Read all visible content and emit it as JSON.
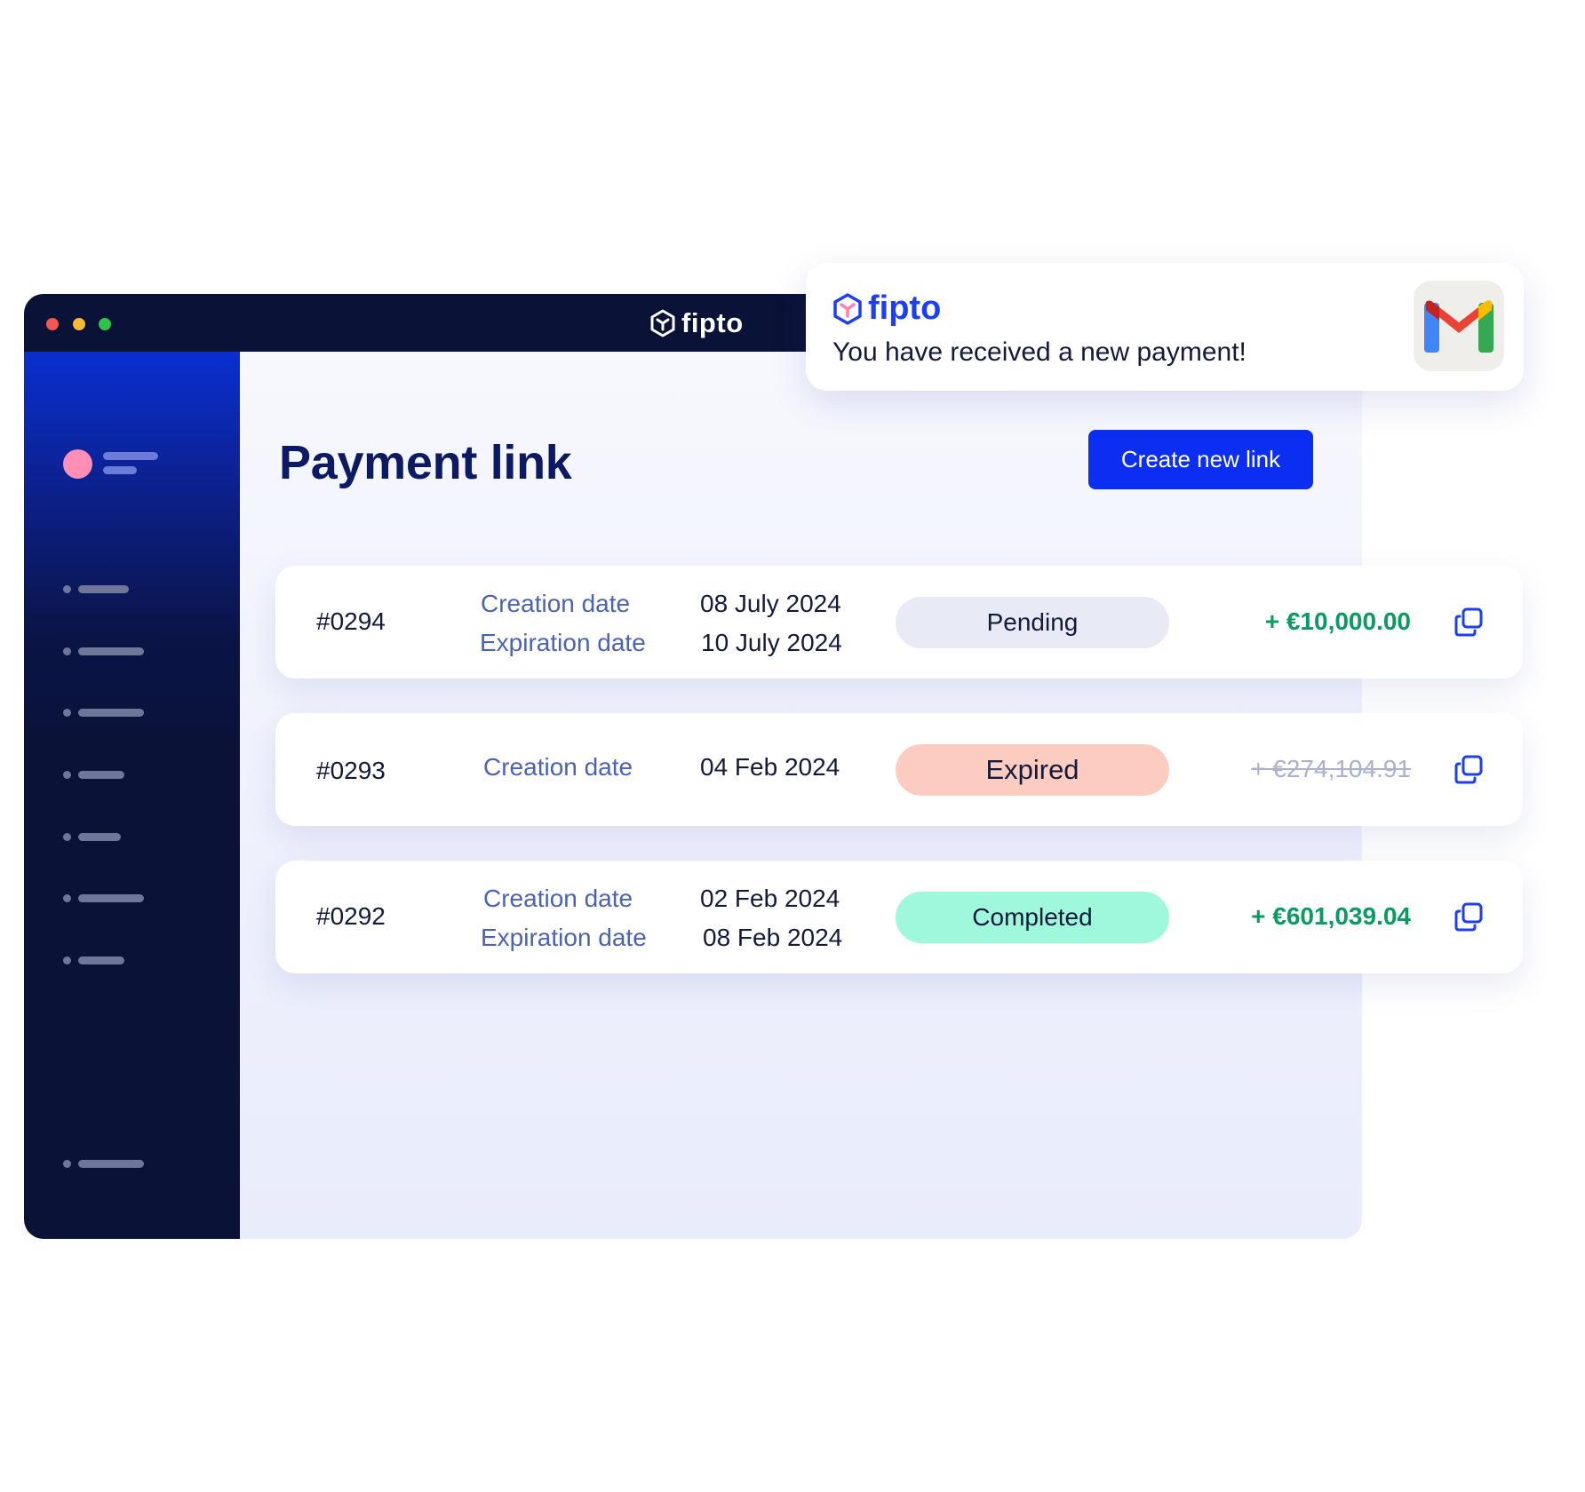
{
  "window": {
    "brand": "fipto"
  },
  "main": {
    "title": "Payment link",
    "create_button": "Create new link"
  },
  "payment_links": [
    {
      "id": "#0294",
      "creation_label": "Creation date",
      "creation_date": "08 July 2024",
      "expiration_label": "Expiration date",
      "expiration_date": "10 July 2024",
      "status": "Pending",
      "amount": "+ €10,000.00"
    },
    {
      "id": "#0293",
      "creation_label": "Creation date",
      "creation_date": "04 Feb 2024",
      "status": "Expired",
      "amount": "+ €274,104.91"
    },
    {
      "id": "#0292",
      "creation_label": "Creation date",
      "creation_date": "02 Feb 2024",
      "expiration_label": "Expiration date",
      "expiration_date": "08 Feb 2024",
      "status": "Completed",
      "amount": "+ €601,039.04"
    }
  ],
  "notification": {
    "brand": "fipto",
    "message": "You have received a new payment!",
    "app_icon": "gmail-icon"
  },
  "colors": {
    "titlebar": "#0a1238",
    "accent": "#0b2ef0",
    "pending": "#e8eaf6",
    "expired": "#fdccc0",
    "completed": "#9ff8dc",
    "positive_amount": "#0a9b63",
    "muted_amount": "#a9b1cf"
  }
}
